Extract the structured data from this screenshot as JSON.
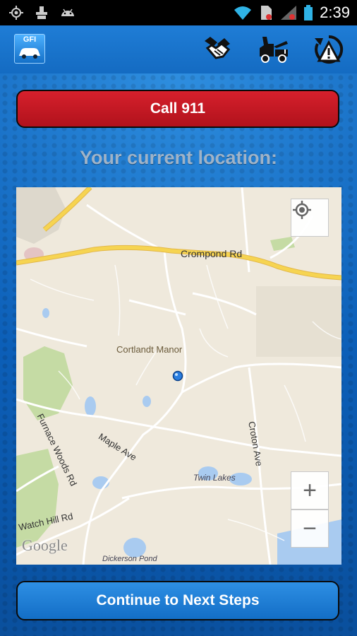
{
  "status_bar": {
    "time": "2:39",
    "icons": [
      "gps-icon",
      "usb-icon",
      "android-debug-icon",
      "wifi-icon",
      "sim-icon",
      "signal-icon",
      "battery-icon"
    ]
  },
  "app_bar": {
    "logo_text": "GFI",
    "actions": [
      "insurance-handshake-icon",
      "tow-truck-icon",
      "roadside-warning-icon"
    ]
  },
  "call_button": {
    "label": "Call 911"
  },
  "location": {
    "heading": "Your current location:"
  },
  "map": {
    "labels": {
      "crompond": "Crompond Rd",
      "cortlandt": "Cortlandt Manor",
      "maple": "Maple Ave",
      "furnace": "Furnace Woods Rd",
      "croton": "Croton Ave",
      "twin": "Twin Lakes",
      "watch": "Watch Hill Rd",
      "dickerson": "Dickerson Pond",
      "google": "Google"
    },
    "zoom_in": "+",
    "zoom_out": "−"
  },
  "next_button": {
    "label": "Continue to Next Steps"
  },
  "colors": {
    "background_blue": "#0c5fb8",
    "call_red": "#c8171f",
    "road_yellow": "#f6d451",
    "my_location_dot": "#2a7ee0"
  }
}
